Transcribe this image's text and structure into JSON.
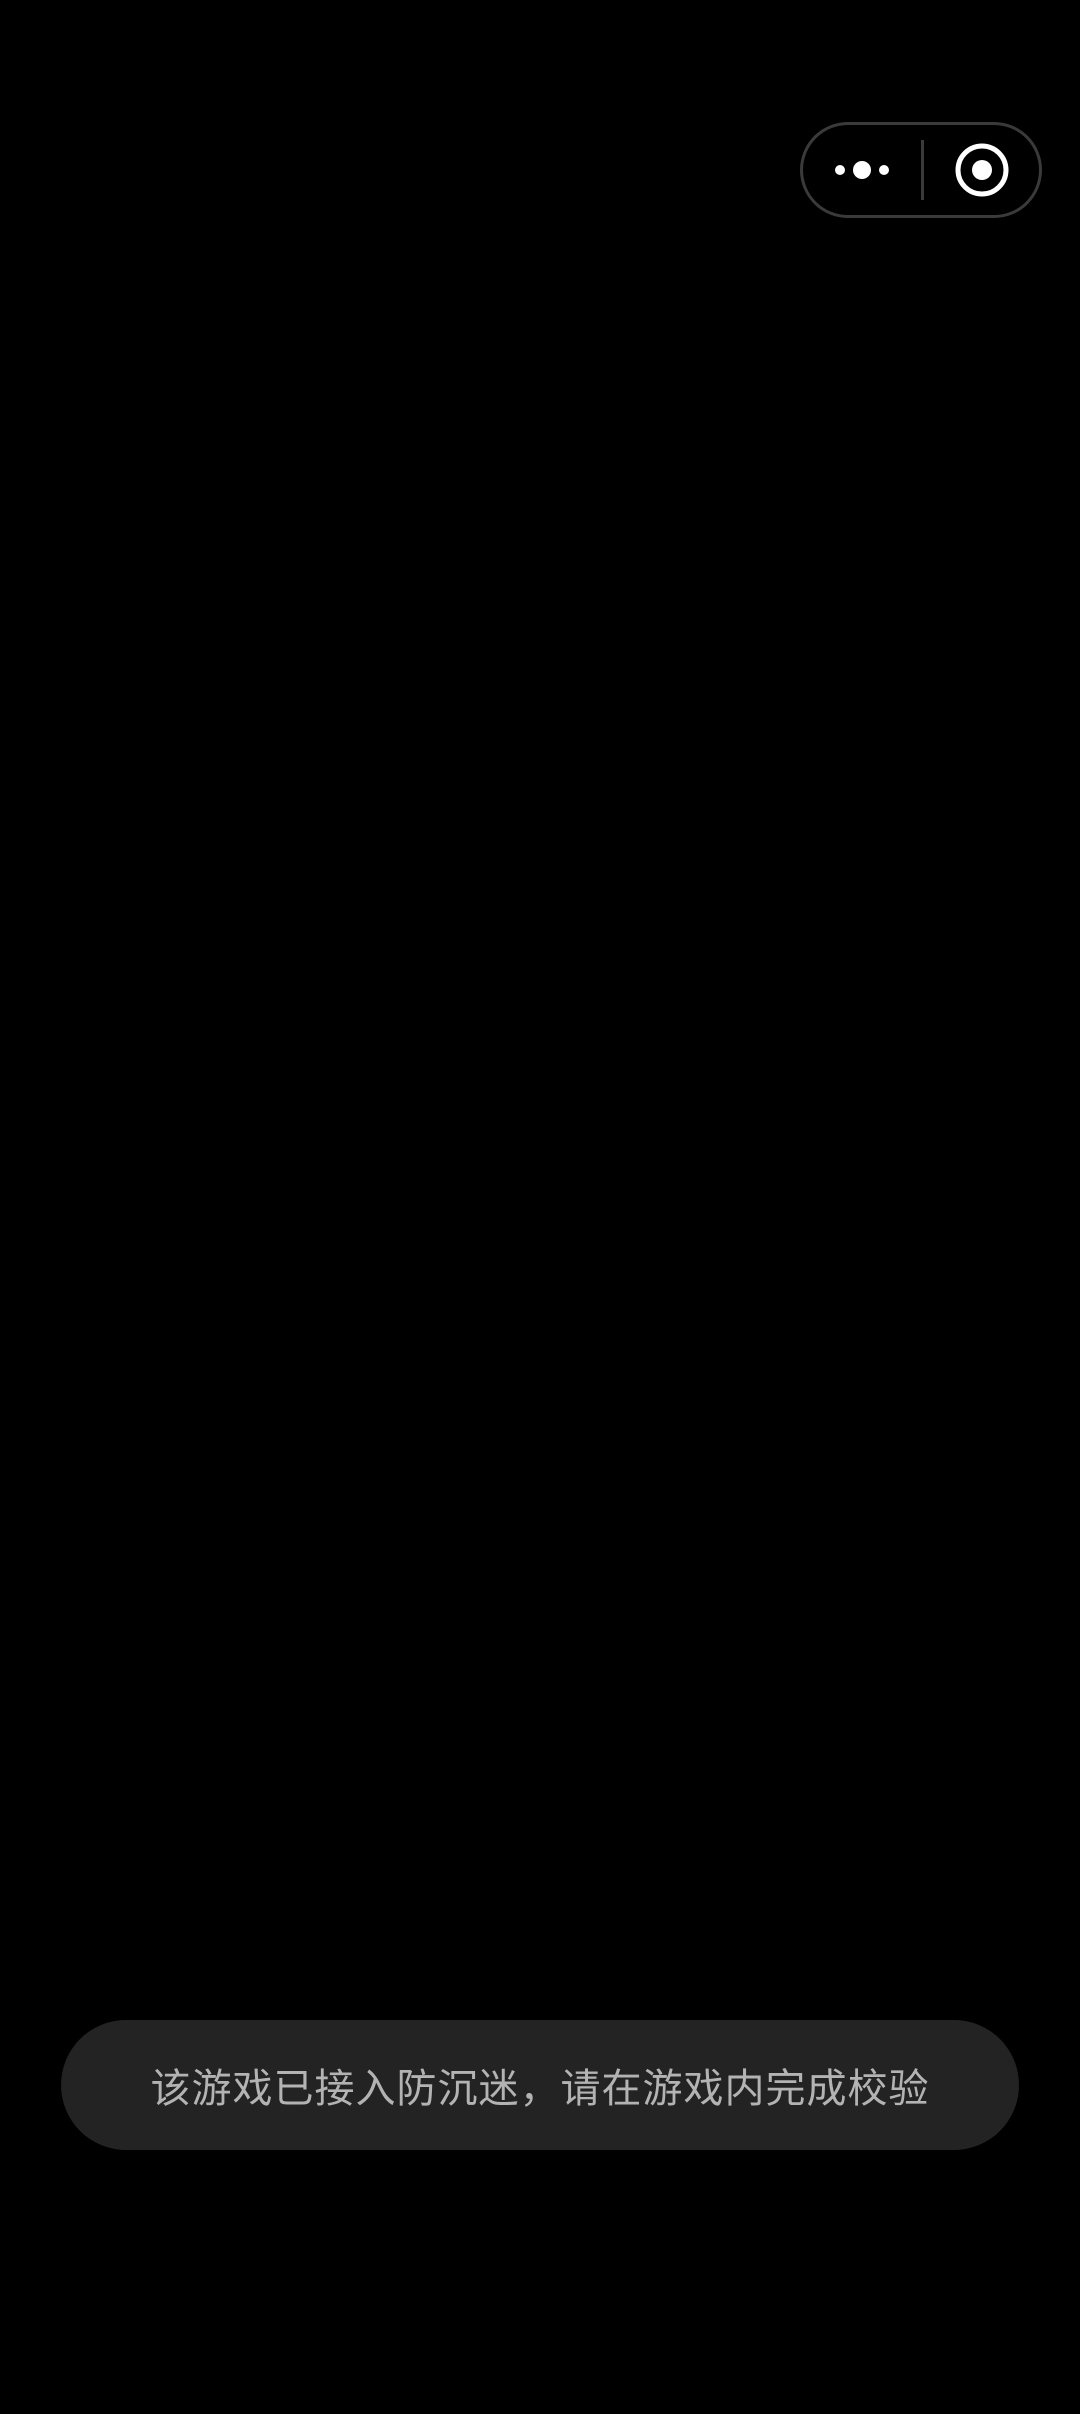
{
  "capsule": {
    "more_icon": "more-dots-icon",
    "close_icon": "exit-target-icon"
  },
  "toast": {
    "message": "该游戏已接入防沉迷，请在游戏内完成校验"
  },
  "colors": {
    "background": "#000000",
    "toast_background": "#232323",
    "toast_text": "#b3b3b3",
    "capsule_border": "#3a3a3a",
    "icon": "#ffffff"
  }
}
